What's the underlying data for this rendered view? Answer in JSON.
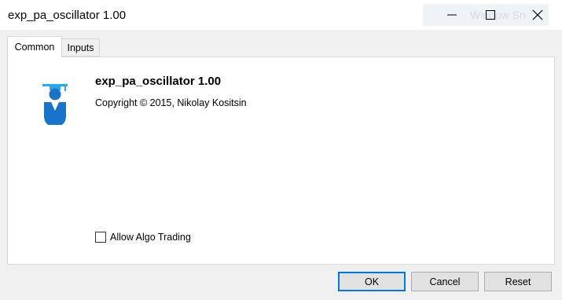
{
  "window": {
    "title": "exp_pa_oscillator 1.00",
    "ghost_text": "Window Sn",
    "controls": {
      "minimize_icon": "minimize-icon",
      "maximize_icon": "maximize-icon",
      "close_icon": "close-icon"
    }
  },
  "tabs": [
    {
      "label": "Common",
      "active": true
    },
    {
      "label": "Inputs",
      "active": false
    }
  ],
  "common": {
    "icon": "graduate-icon",
    "name": "exp_pa_oscillator 1.00",
    "copyright": "Copyright © 2015, Nikolay Kositsin",
    "allow_algo_trading": {
      "label": "Allow Algo Trading",
      "checked": false
    }
  },
  "buttons": {
    "ok": "OK",
    "cancel": "Cancel",
    "reset": "Reset"
  },
  "colors": {
    "accent": "#0078d7",
    "icon_blue": "#1a73c8",
    "icon_cap": "#2aa7e8"
  }
}
